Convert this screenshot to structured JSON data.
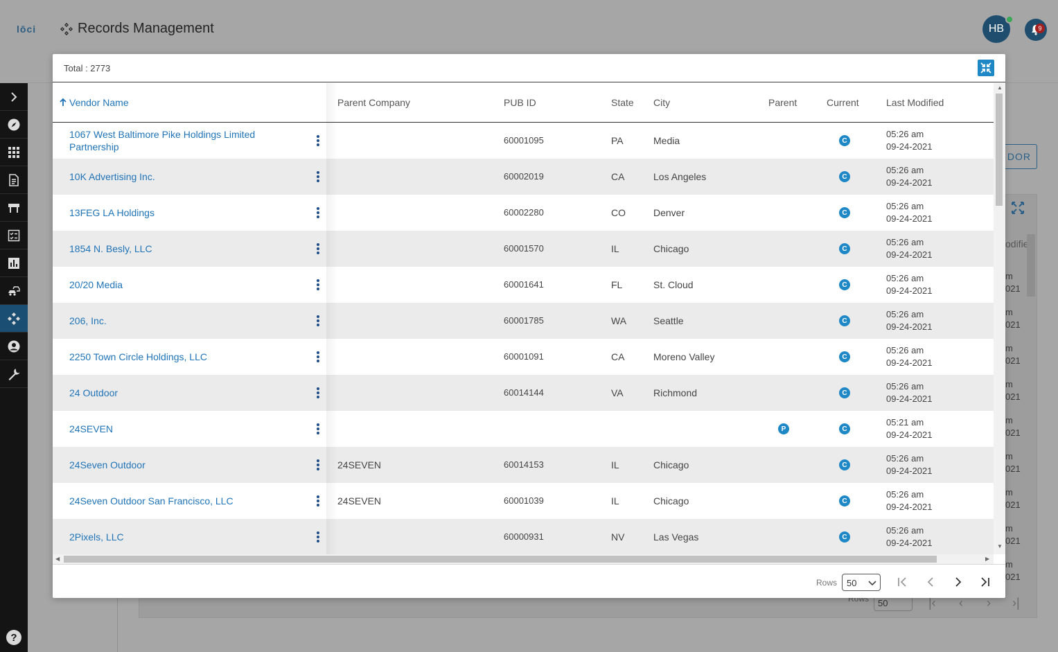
{
  "app": {
    "logo": "lōci",
    "title": "Records Management",
    "user_initials": "HB",
    "notification_count": "9"
  },
  "background": {
    "vendor_button": "DOR",
    "column_partial": "odifie",
    "rows_label": "Rows",
    "rows_value": "50"
  },
  "modal": {
    "total": "Total : 2773",
    "columns": {
      "vendor_name": "Vendor Name",
      "parent_company": "Parent Company",
      "pub_id": "PUB ID",
      "state": "State",
      "city": "City",
      "parent": "Parent",
      "current": "Current",
      "last_modified": "Last Modified"
    },
    "rows": [
      {
        "vendor": "1067 West Baltimore Pike Holdings Limited Partnership",
        "parent_company": "",
        "pub_id": "60001095",
        "state": "PA",
        "city": "Media",
        "parent_flag": "",
        "current_flag": "C",
        "time": "05:26 am",
        "date": "09-24-2021"
      },
      {
        "vendor": "10K Advertising Inc.",
        "parent_company": "",
        "pub_id": "60002019",
        "state": "CA",
        "city": "Los Angeles",
        "parent_flag": "",
        "current_flag": "C",
        "time": "05:26 am",
        "date": "09-24-2021"
      },
      {
        "vendor": "13FEG LA Holdings",
        "parent_company": "",
        "pub_id": "60002280",
        "state": "CO",
        "city": "Denver",
        "parent_flag": "",
        "current_flag": "C",
        "time": "05:26 am",
        "date": "09-24-2021"
      },
      {
        "vendor": "1854 N. Besly, LLC",
        "parent_company": "",
        "pub_id": "60001570",
        "state": "IL",
        "city": "Chicago",
        "parent_flag": "",
        "current_flag": "C",
        "time": "05:26 am",
        "date": "09-24-2021"
      },
      {
        "vendor": "20/20 Media",
        "parent_company": "",
        "pub_id": "60001641",
        "state": "FL",
        "city": "St. Cloud",
        "parent_flag": "",
        "current_flag": "C",
        "time": "05:26 am",
        "date": "09-24-2021"
      },
      {
        "vendor": "206, Inc.",
        "parent_company": "",
        "pub_id": "60001785",
        "state": "WA",
        "city": "Seattle",
        "parent_flag": "",
        "current_flag": "C",
        "time": "05:26 am",
        "date": "09-24-2021"
      },
      {
        "vendor": "2250 Town Circle Holdings, LLC",
        "parent_company": "",
        "pub_id": "60001091",
        "state": "CA",
        "city": "Moreno Valley",
        "parent_flag": "",
        "current_flag": "C",
        "time": "05:26 am",
        "date": "09-24-2021"
      },
      {
        "vendor": "24 Outdoor",
        "parent_company": "",
        "pub_id": "60014144",
        "state": "VA",
        "city": "Richmond",
        "parent_flag": "",
        "current_flag": "C",
        "time": "05:26 am",
        "date": "09-24-2021"
      },
      {
        "vendor": "24SEVEN",
        "parent_company": "",
        "pub_id": "",
        "state": "",
        "city": "",
        "parent_flag": "P",
        "current_flag": "C",
        "time": "05:21 am",
        "date": "09-24-2021"
      },
      {
        "vendor": "24Seven Outdoor",
        "parent_company": "24SEVEN",
        "pub_id": "60014153",
        "state": "IL",
        "city": "Chicago",
        "parent_flag": "",
        "current_flag": "C",
        "time": "05:26 am",
        "date": "09-24-2021"
      },
      {
        "vendor": "24Seven Outdoor San Francisco, LLC",
        "parent_company": "24SEVEN",
        "pub_id": "60001039",
        "state": "IL",
        "city": "Chicago",
        "parent_flag": "",
        "current_flag": "C",
        "time": "05:26 am",
        "date": "09-24-2021"
      },
      {
        "vendor": "2Pixels, LLC",
        "parent_company": "",
        "pub_id": "60000931",
        "state": "NV",
        "city": "Las Vegas",
        "parent_flag": "",
        "current_flag": "C",
        "time": "05:26 am",
        "date": "09-24-2021"
      }
    ],
    "footer": {
      "rows_label": "Rows",
      "rows_value": "50"
    }
  },
  "colors": {
    "accent": "#1e88c7",
    "link": "#1f73b7",
    "sidebar": "#141414",
    "sidebar_active": "#1b4e73"
  }
}
